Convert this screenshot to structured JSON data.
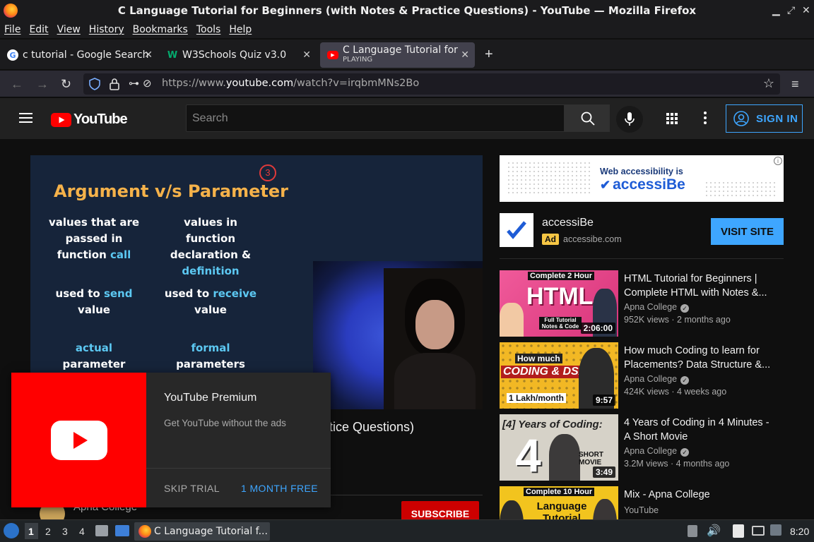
{
  "window": {
    "title": "C Language Tutorial for Beginners (with Notes & Practice Questions) - YouTube — Mozilla Firefox"
  },
  "menu": [
    "File",
    "Edit",
    "View",
    "History",
    "Bookmarks",
    "Tools",
    "Help"
  ],
  "tabs": [
    {
      "label": "c tutorial - Google Search",
      "icon": "google-icon"
    },
    {
      "label": "W3Schools Quiz v3.0",
      "icon": "w3schools-icon"
    },
    {
      "label": "C Language Tutorial for B",
      "sub": "PLAYING",
      "icon": "youtube-icon",
      "active": true
    }
  ],
  "url": {
    "prefix": "https://www.",
    "domain": "youtube.com",
    "path": "/watch?v=irqbmMNs2Bo"
  },
  "youtube": {
    "logo_text": "YouTube",
    "search_placeholder": "Search",
    "sign_in": "SIGN IN"
  },
  "slide": {
    "title": "Argument v/s Parameter",
    "mark": "3",
    "left": [
      {
        "pre": "values that are\npassed in\nfunction ",
        "hl": "call"
      },
      {
        "pre": "used to ",
        "hl": "send",
        "post": "\nvalue"
      },
      {
        "pre": "",
        "hl": "actual",
        "post": "\nparameter"
      }
    ],
    "right": [
      {
        "pre": "values in function\ndeclaration &\n",
        "hl": "definition"
      },
      {
        "pre": "used to ",
        "hl": "receive",
        "post": "\nvalue"
      },
      {
        "pre": "",
        "hl": "formal",
        "post": "\nparameters"
      }
    ]
  },
  "video_title_fragment": "tice Questions)",
  "channel_partial": "Apna College",
  "subscribe": "SUBSCRIBE",
  "ad": {
    "banner_line1": "Web accessibility is",
    "banner_brand": "accessiBe",
    "name": "accessiBe",
    "badge": "Ad",
    "domain": "accessibe.com",
    "cta": "VISIT SITE"
  },
  "recommendations": [
    {
      "title": "HTML Tutorial for Beginners | Complete HTML with Notes &...",
      "channel": "Apna College",
      "verified": true,
      "meta": "952K views · 2 months ago",
      "duration": "2:06:00",
      "thumb_text": "HTML",
      "thumb_top": "Complete 2 Hour",
      "thumb_sub": "Full Tutorial Notes & Code"
    },
    {
      "title": "How much Coding to learn for Placements? Data Structure &...",
      "channel": "Apna College",
      "verified": true,
      "meta": "424K views · 4 weeks ago",
      "duration": "9:57",
      "thumb_text": "CODING & DSA",
      "thumb_top": "How much",
      "thumb_sub": "1 Lakh/month"
    },
    {
      "title": "4 Years of Coding in 4 Minutes - A Short Movie",
      "channel": "Apna College",
      "verified": true,
      "meta": "3.2M views · 4 months ago",
      "duration": "3:49",
      "thumb_text": "[4] Years of Coding:",
      "thumb_top": "",
      "thumb_sub": "SHORT MOVIE"
    },
    {
      "title": "Mix - Apna College",
      "channel": "YouTube",
      "verified": false,
      "meta": "",
      "duration": "",
      "thumb_text": "Language Tutorial",
      "thumb_top": "Complete 10 Hour",
      "thumb_sub": ""
    }
  ],
  "premium": {
    "title": "YouTube Premium",
    "desc": "Get YouTube without the ads",
    "skip": "SKIP TRIAL",
    "free": "1 MONTH FREE"
  },
  "taskbar": {
    "workspaces": [
      "1",
      "2",
      "3",
      "4"
    ],
    "app_label": "C Language Tutorial f...",
    "clock": "8:20"
  }
}
